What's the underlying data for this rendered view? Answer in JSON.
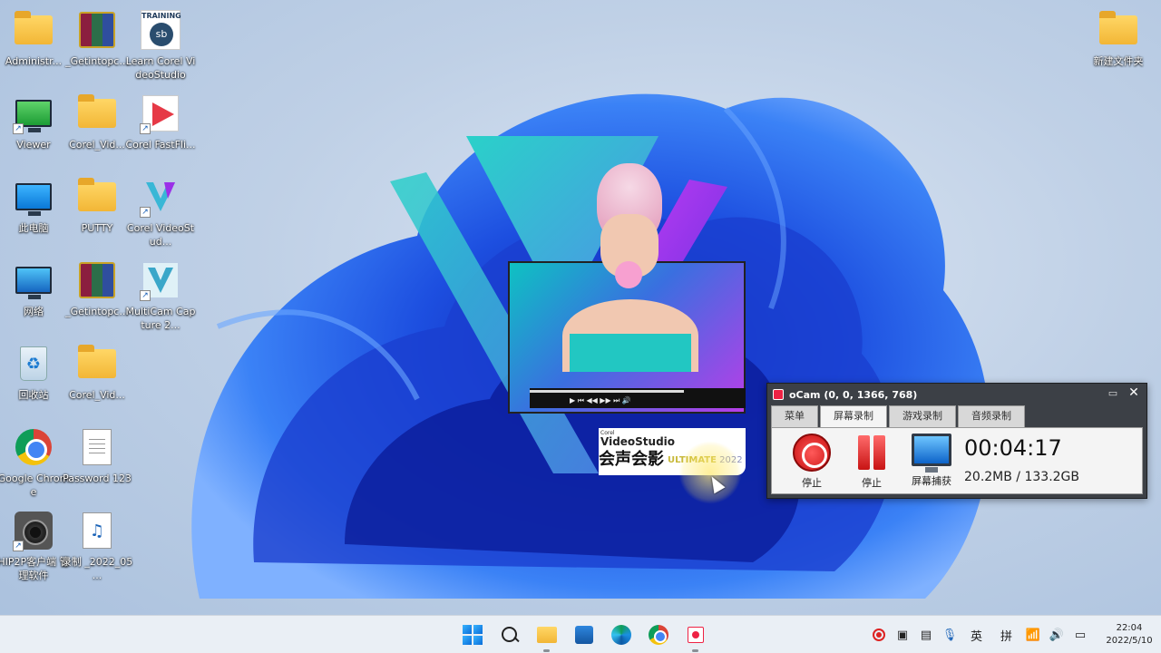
{
  "desktop": {
    "icons": [
      {
        "label": "Administr...",
        "icon": "folder-icon"
      },
      {
        "label": "_Getintopc...",
        "icon": "winrar-icon"
      },
      {
        "label": "Learn Corel VideoStudio",
        "icon": "training-icon"
      },
      {
        "label": "Viewer",
        "icon": "viewer-app-icon"
      },
      {
        "label": "Corel_Vid...",
        "icon": "folder-icon"
      },
      {
        "label": "Corel FastFli...",
        "icon": "corel-fastflick-icon"
      },
      {
        "label": "此电脑",
        "icon": "this-pc-icon"
      },
      {
        "label": "PUTTY",
        "icon": "folder-icon"
      },
      {
        "label": "Corel VideoStud...",
        "icon": "corel-videostudio-icon"
      },
      {
        "label": "网络",
        "icon": "network-icon"
      },
      {
        "label": "_Getintopc...",
        "icon": "winrar-icon"
      },
      {
        "label": "MultiCam Capture 2...",
        "icon": "multicam-capture-icon"
      },
      {
        "label": "回收站",
        "icon": "recycle-bin-icon"
      },
      {
        "label": "Corel_Vid...",
        "icon": "folder-icon"
      },
      {
        "label": "Google Chrome",
        "icon": "chrome-icon"
      },
      {
        "label": "Password 123",
        "icon": "text-document-icon"
      },
      {
        "label": "HIP2P客户端 管理软件",
        "icon": "camera-app-icon"
      },
      {
        "label": "录制 _2022_05 ...",
        "icon": "audio-file-icon"
      },
      {
        "label": "新建文件夹",
        "icon": "folder-icon"
      }
    ]
  },
  "splash": {
    "corel_label": "Corel",
    "product_name": "VideoStudio",
    "product_name_cn": "会声会影",
    "edition": "ULTIMATE",
    "year": "2022"
  },
  "ocam": {
    "title": "oCam (0, 0, 1366, 768)",
    "tabs": [
      "菜单",
      "屏幕录制",
      "游戏录制",
      "音频录制"
    ],
    "active_tab": "屏幕录制",
    "buttons": {
      "stop_label": "停止",
      "pause_label": "停止",
      "screen_capture_label": "屏幕捕获"
    },
    "elapsed": "00:04:17",
    "size_info": "20.2MB / 133.2GB",
    "accent_color": "#d21e1e"
  },
  "taskbar": {
    "apps": [
      "start-icon",
      "search-icon",
      "file-explorer-icon",
      "microsoft-store-icon",
      "edge-icon",
      "chrome-icon",
      "ocam-icon"
    ],
    "tray": {
      "ime_lang": "英",
      "ime_mode": "拼",
      "time": "22:04",
      "date": "2022/5/10"
    }
  }
}
